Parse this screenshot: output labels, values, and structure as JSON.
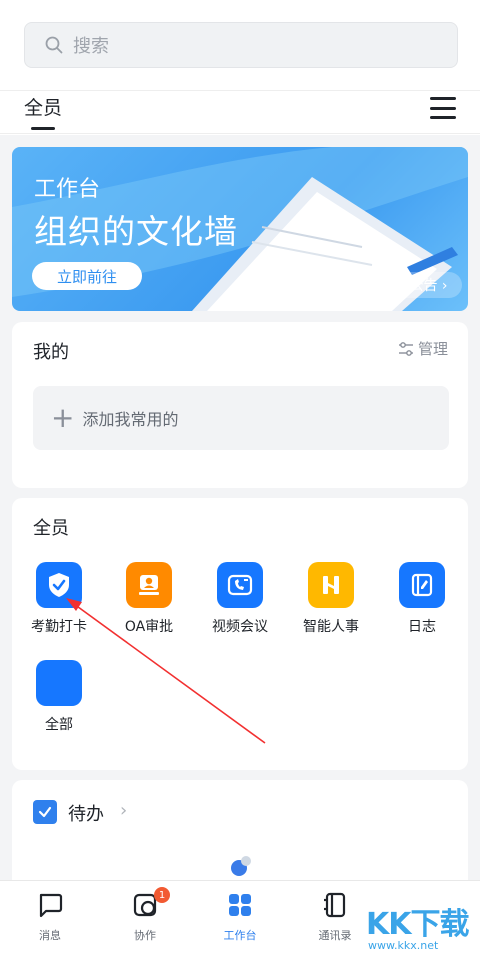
{
  "search": {
    "placeholder": "搜索"
  },
  "tabs": {
    "active": "全员"
  },
  "banner": {
    "title": "工作台",
    "subtitle": "组织的文化墙",
    "button": "立即前往",
    "notice": "全部公告 ›"
  },
  "mine": {
    "title": "我的",
    "manage": "管理",
    "add": "添加我常用的"
  },
  "all": {
    "title": "全员",
    "apps": [
      {
        "label": "考勤打卡",
        "icon": "checkin-shield-icon",
        "color": "#1677ff"
      },
      {
        "label": "OA审批",
        "icon": "oa-approval-icon",
        "color": "#ff8a00"
      },
      {
        "label": "视频会议",
        "icon": "video-call-icon",
        "color": "#1677ff"
      },
      {
        "label": "智能人事",
        "icon": "hr-icon",
        "color": "#ffb800"
      },
      {
        "label": "日志",
        "icon": "log-icon",
        "color": "#1677ff"
      },
      {
        "label": "全部",
        "icon": "all-apps-icon",
        "color": "#1677ff"
      }
    ]
  },
  "todo": {
    "label": "待办"
  },
  "bottom_nav": [
    {
      "label": "消息",
      "icon": "message-icon"
    },
    {
      "label": "协作",
      "icon": "collab-icon",
      "badge": "1"
    },
    {
      "label": "工作台",
      "icon": "workbench-icon",
      "active": true
    },
    {
      "label": "通讯录",
      "icon": "contacts-icon"
    }
  ],
  "watermark": {
    "logo": "KK下载",
    "url": "www.kkx.net"
  },
  "colors": {
    "accent": "#2f80ed",
    "annotation_arrow": "#f23030"
  }
}
